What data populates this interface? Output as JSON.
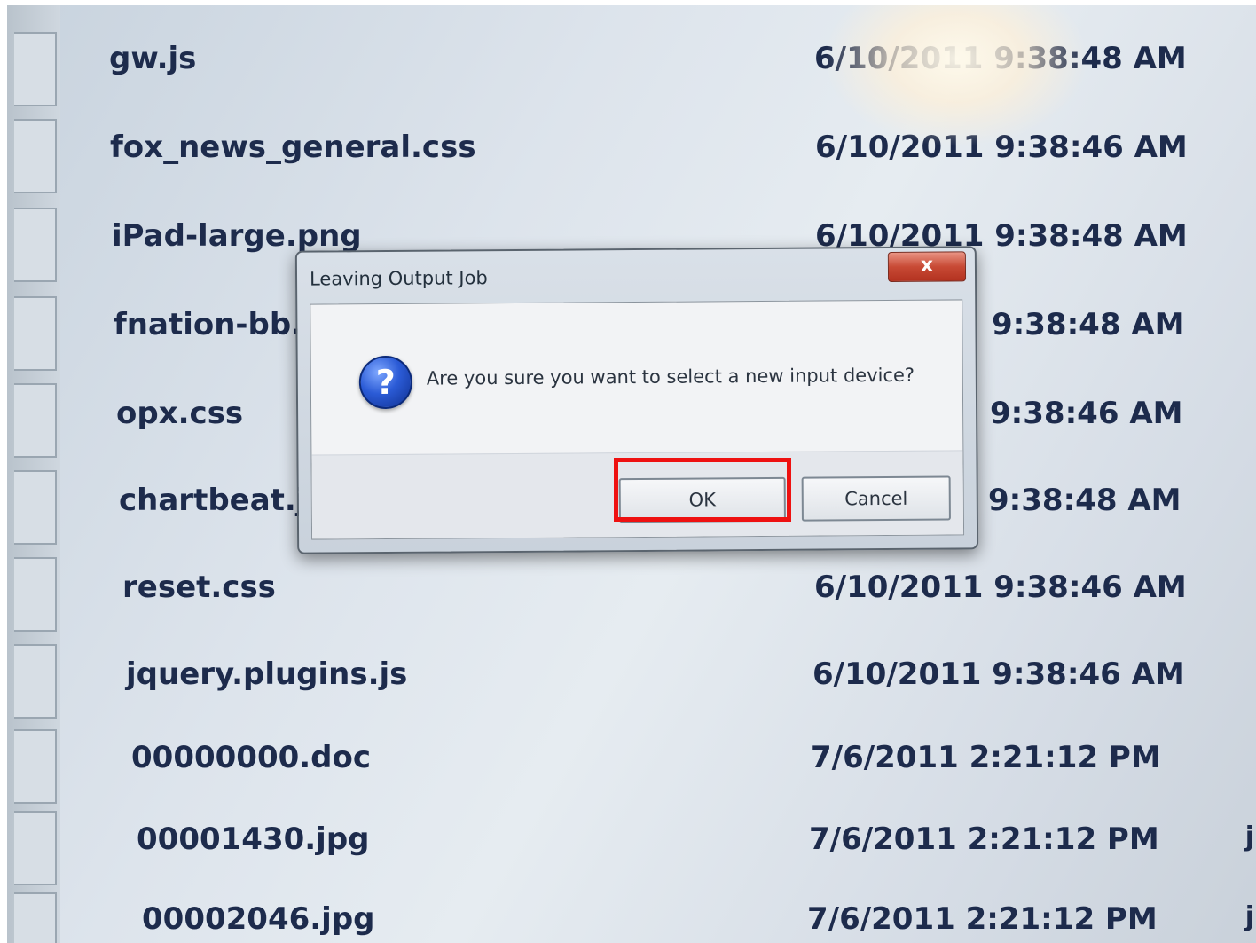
{
  "file_list": {
    "rows": [
      {
        "name": "gw.js",
        "date": "6/10/2011 9:38:48 AM"
      },
      {
        "name": "fox_news_general.css",
        "date": "6/10/2011 9:38:46 AM"
      },
      {
        "name": "iPad-large.png",
        "date": "6/10/2011 9:38:48 AM"
      },
      {
        "name": "fnation-bb.",
        "date": "9:38:48 AM"
      },
      {
        "name": "opx.css",
        "date": "9:38:46 AM"
      },
      {
        "name": "chartbeat.js",
        "date": "9:38:48 AM"
      },
      {
        "name": "reset.css",
        "date": "6/10/2011 9:38:46 AM"
      },
      {
        "name": "jquery.plugins.js",
        "date": "6/10/2011 9:38:46 AM"
      },
      {
        "name": "00000000.doc",
        "date": "7/6/2011 2:21:12 PM"
      },
      {
        "name": "00001430.jpg",
        "date": "7/6/2011 2:21:12 PM"
      },
      {
        "name": "00002046.jpg",
        "date": "7/6/2011 2:21:12 PM"
      }
    ],
    "edge_chars": [
      "j",
      "j"
    ]
  },
  "dialog": {
    "title": "Leaving Output Job",
    "close_label": "x",
    "icon": "question-icon",
    "message": "Are you sure you want to select a new input device?",
    "ok_label": "OK",
    "cancel_label": "Cancel"
  },
  "colors": {
    "text": "#1d2b4c",
    "highlight": "#ee1111",
    "close_button": "#c84a35"
  }
}
